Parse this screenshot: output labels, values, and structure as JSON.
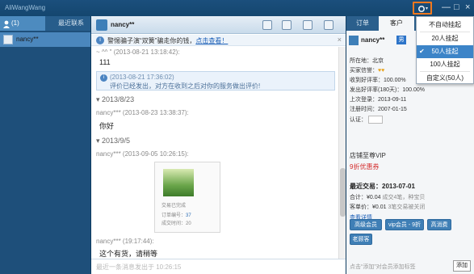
{
  "titlebar": {
    "app_title": "AliWangWang",
    "minimize": "—",
    "maximize": "□",
    "close": "×"
  },
  "left_panel": {
    "tabs": [
      {
        "label": "(1)"
      },
      {
        "label": "最近联系"
      }
    ],
    "contact_name": "nancy**"
  },
  "chat": {
    "nick": "nancy**",
    "notice": {
      "text": "警惕骗子演“双簧”骗走你的钱，",
      "link": "点击查看！"
    },
    "messages": [
      {
        "meta": "~ ^^ \" (2013-08-21 13:18:42):",
        "text": "111"
      },
      {
        "sys_time": "(2013-08-21 17:36:02)",
        "sys_text": "评价已经发出，对方在收到之后对你的服务做出评价!"
      },
      {
        "date": "2013/8/23"
      },
      {
        "meta": "nancy*** (2013-08-23 13:38:37):",
        "text": "你好"
      },
      {
        "date": "2013/9/5"
      },
      {
        "meta": "nancy*** (2013-09-05 10:26:15):"
      }
    ],
    "card": {
      "status": "交易已完成",
      "order_label": "订单编号：",
      "order_value": "37",
      "time_label": "成交时间：",
      "time_value": "20"
    },
    "last_meta": "nancy*** (19:17:44):",
    "last_text": "这个有货，请稍等",
    "input_placeholder": "最近一条消息发出于 10:26:15"
  },
  "right_panel": {
    "tabs": [
      {
        "label": "订单"
      },
      {
        "label": "客户"
      }
    ],
    "nick": "nancy**",
    "badge": "男",
    "location_label": "所在地：",
    "location": "北京",
    "buyer_credit_label": "买家信誉：",
    "buyer_credit_value": "♥♥",
    "good_rate_label": "收到好评率：",
    "good_rate": "100.00%",
    "sent_rate_label": "发出好评率(180天)：",
    "sent_rate": "100.00%",
    "last_login_label": "上次登录：",
    "last_login": "2013-09-11",
    "reg_label": "注册时间：",
    "reg_time": "2007-01-15",
    "verify_label": "认证：",
    "vip_title": "店铺至尊VIP",
    "vip_discount": "9折优惠券",
    "last_deal_title": "最近交易：",
    "last_deal_date": "2013-07-01",
    "total_label": "合计：",
    "total_value": "¥0.04",
    "total_note": "成交4笔，种宝贝",
    "avg_label": "客单价：",
    "avg_value": "¥0.01",
    "avg_note": "3笔交易被关闭",
    "detail_link": "查看详情",
    "tags": [
      "高级会员",
      "vip会员 - 9折",
      "高消费",
      "老顾客"
    ],
    "note_hint": "点击“添加”对会员添加标签",
    "add_label": "添加"
  },
  "dropdown": {
    "items": [
      {
        "label": "不自动挂起",
        "selected": false
      },
      {
        "label": "20人挂起",
        "selected": false
      },
      {
        "label": "50人挂起",
        "selected": true
      },
      {
        "label": "100人挂起",
        "selected": false
      },
      {
        "label": "自定义(50人)",
        "selected": false
      }
    ],
    "selected_color": "#3c84c8"
  }
}
